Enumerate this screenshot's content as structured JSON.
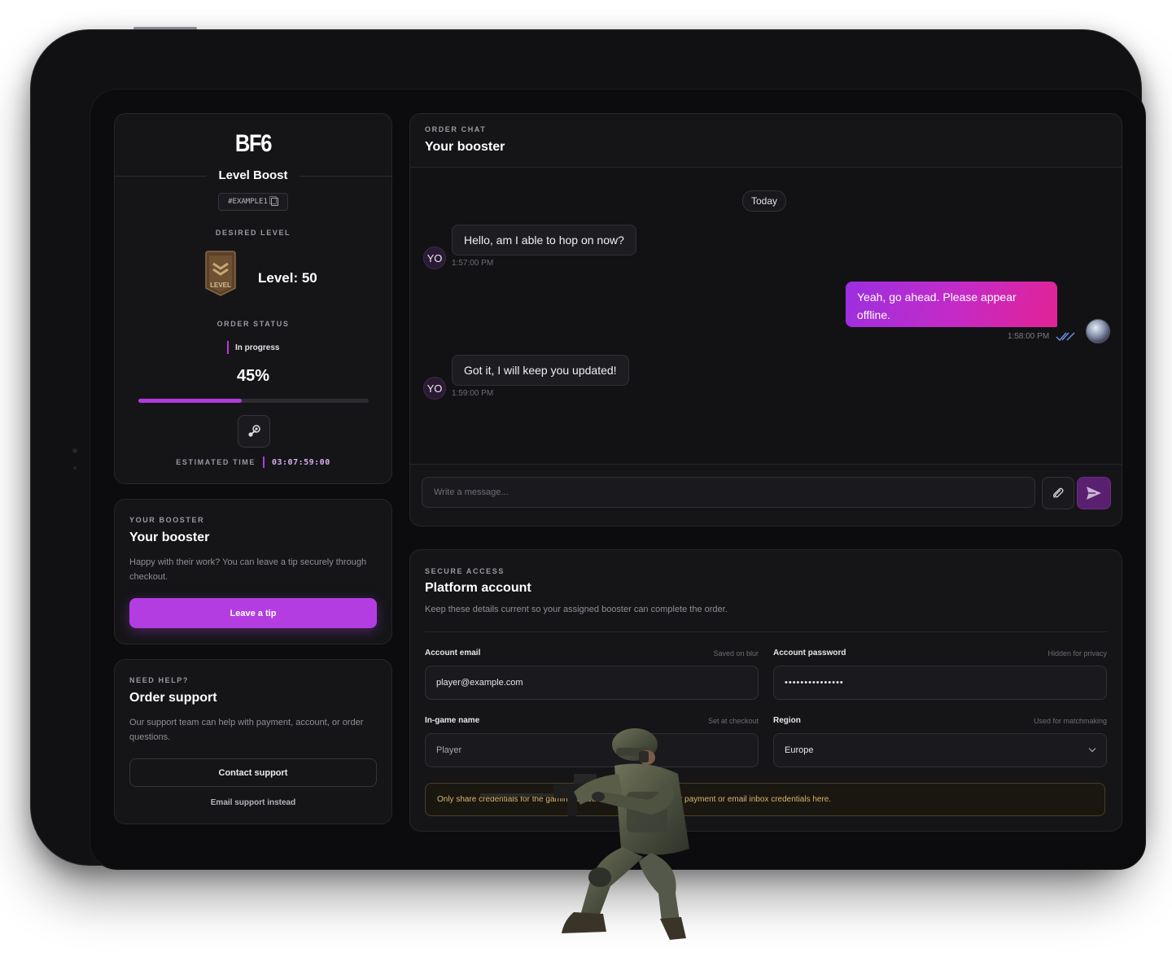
{
  "order": {
    "logo": "BF6",
    "title": "Level Boost",
    "order_id": "#EXAMPLE1",
    "desired_level_label": "DESIRED LEVEL",
    "level_badge_text": "LEVEL",
    "level_value": "Level: 50",
    "order_status_label": "ORDER STATUS",
    "status": "In progress",
    "progress_percent": 45,
    "progress_text": "45%",
    "estimated_time_label": "ESTIMATED TIME",
    "estimated_time": "03:07:59:00",
    "accent_color": "#b13bdb"
  },
  "booster_card": {
    "eyebrow": "YOUR BOOSTER",
    "title": "Your booster",
    "body": "Happy with their work? You can leave a tip securely through checkout.",
    "tip_button": "Leave a tip"
  },
  "support_card": {
    "eyebrow": "NEED HELP?",
    "title": "Order support",
    "body": "Our support team can help with payment, account, or order questions.",
    "contact_button": "Contact support",
    "email_link": "Email support instead"
  },
  "chat": {
    "eyebrow": "ORDER CHAT",
    "title": "Your booster",
    "date_divider": "Today",
    "messages": [
      {
        "from": "booster",
        "avatar": "YO",
        "text": "Hello, am I able to hop on now?",
        "time": "1:57:00 PM"
      },
      {
        "from": "me",
        "text": "Yeah, go ahead. Please appear offline.",
        "time": "1:58:00 PM",
        "read": true
      },
      {
        "from": "booster",
        "avatar": "YO",
        "text": "Got it, I will keep you updated!",
        "time": "1:59:00 PM"
      }
    ],
    "input_placeholder": "Write a message..."
  },
  "account": {
    "eyebrow": "SECURE ACCESS",
    "title": "Platform account",
    "description": "Keep these details current so your assigned booster can complete the order.",
    "email_label": "Account email",
    "email_hint": "Saved on blur",
    "email_value": "player@example.com",
    "password_label": "Account password",
    "password_hint": "Hidden for privacy",
    "password_value": "•••••••••••••••",
    "ign_label": "In-game name",
    "ign_hint": "Set at checkout",
    "ign_value": "Player",
    "region_label": "Region",
    "region_hint": "Used for matchmaking",
    "region_value": "Europe",
    "warning": "Only share credentials for the gaming account required. Never enter payment or email inbox credentials here."
  }
}
